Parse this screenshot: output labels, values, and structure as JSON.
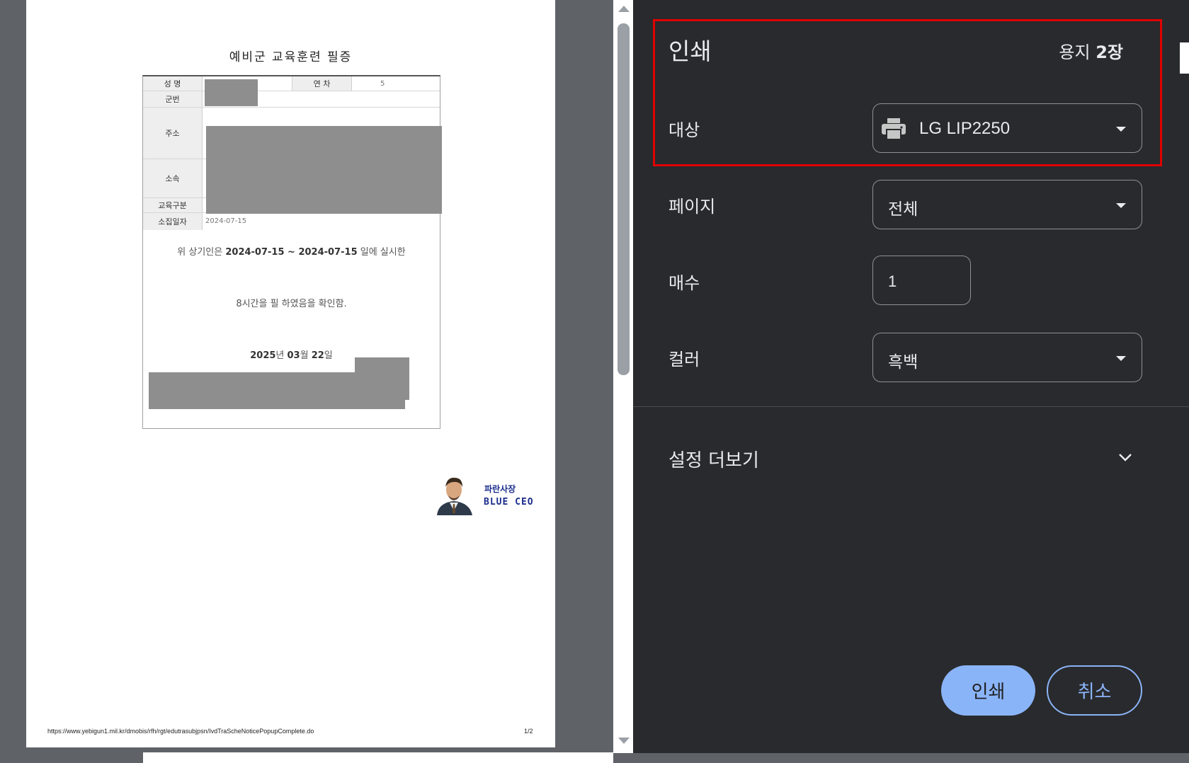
{
  "document": {
    "title": "예비군 교육훈련 필증",
    "fields": {
      "name_label": "성 명",
      "year_label": "연 차",
      "year_value": "5",
      "service_number_label": "군번",
      "address_label": "주소",
      "unit_label": "소속",
      "training_type_label": "교육구분",
      "call_date_label": "소집일자",
      "call_date_value": "2024-07-15"
    },
    "statement": {
      "prefix": "위 상기인은 ",
      "start_date": "2024-07-15",
      "tilde": " ~ ",
      "end_date": "2024-07-15",
      "suffix": " 일에 실시한",
      "hours_line": "8시간을 필 하였음을 확인함."
    },
    "issue_date": {
      "year": "2025",
      "year_unit": "년 ",
      "month": "03",
      "month_unit": "월 ",
      "day": "22",
      "day_unit": "일"
    },
    "logo": {
      "korean": "파란사장",
      "english": "BLUE CEO"
    },
    "footer": {
      "url": "https://www.yebigun1.mil.kr/dmobis/rfh/rgt/edutrasubjpsn/IvdTraScheNoticePopupComplete.do",
      "page": "1/2"
    }
  },
  "print_panel": {
    "title": "인쇄",
    "sheets_prefix": "용지 ",
    "sheets_count": "2장",
    "destination_label": "대상",
    "destination_value": "LG LIP2250",
    "pages_label": "페이지",
    "pages_value": "전체",
    "copies_label": "매수",
    "copies_value": "1",
    "color_label": "컬러",
    "color_value": "흑백",
    "more_settings_label": "설정 더보기",
    "print_button": "인쇄",
    "cancel_button": "취소"
  },
  "colors": {
    "panel_bg": "#292a2d",
    "accent": "#8ab4f8",
    "highlight_border": "#e00000"
  }
}
